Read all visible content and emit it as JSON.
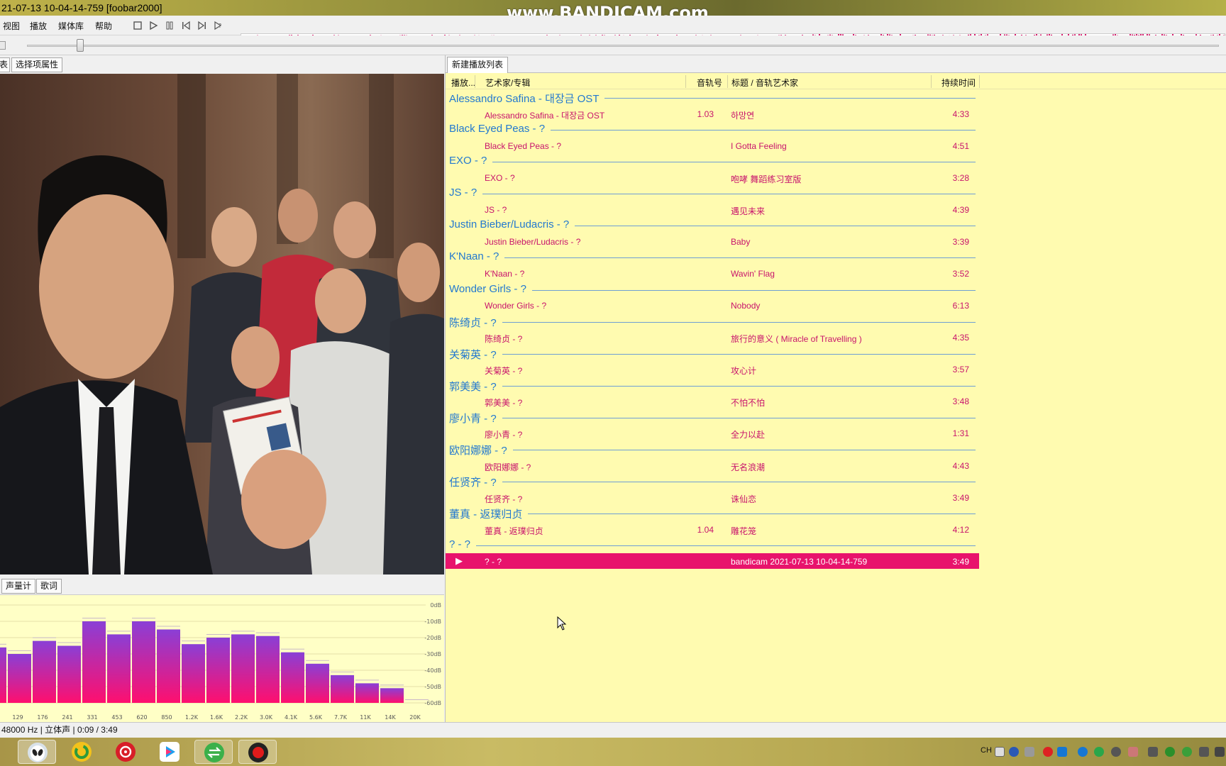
{
  "window": {
    "title": "21-07-13 10-04-14-759  [foobar2000]",
    "watermark": "www.BANDICAM.com"
  },
  "menu": {
    "items": [
      "视图",
      "播放",
      "媒体库",
      "帮助"
    ]
  },
  "toolbar": {
    "buttons": [
      "stop-icon",
      "play-icon",
      "pause-icon",
      "previous-icon",
      "next-icon",
      "random-icon"
    ]
  },
  "seek": {
    "position_fraction": 0.04
  },
  "left_panel": {
    "top_tabs": [
      "表",
      "选择项属性"
    ],
    "bottom_tabs": [
      "声量计",
      "歌词"
    ],
    "album_art": "movie-still-image"
  },
  "spectrum": {
    "db_labels": [
      "0dB",
      "-10dB",
      "-20dB",
      "-30dB",
      "-40dB",
      "-50dB",
      "-60dB"
    ],
    "freq_labels": [
      "129",
      "176",
      "241",
      "331",
      "453",
      "620",
      "850",
      "1.2K",
      "1.6K",
      "2.2K",
      "3.0K",
      "4.1K",
      "5.6K",
      "7.7K",
      "11K",
      "14K",
      "20K"
    ],
    "bar_levels_db": [
      -26,
      -30,
      -22,
      -25,
      -10,
      -18,
      -10,
      -15,
      -24,
      -20,
      -18,
      -19,
      -29,
      -36,
      -43,
      -48,
      -51,
      -60
    ],
    "colors": {
      "top": "#8a3fd6",
      "bottom": "#ff0f6e"
    }
  },
  "playlist": {
    "tab": "新建播放列表",
    "columns": {
      "playing": "播放...",
      "artist_album": "艺术家/专辑",
      "track_no": "音轨号",
      "title_artist": "标题 / 音轨艺术家",
      "duration": "持续时间"
    },
    "groups": [
      {
        "header": "Alessandro Safina - 대장금 OST",
        "tracks": [
          {
            "artist": "Alessandro Safina - 대장금 OST",
            "num": "1.03",
            "title": "하망연",
            "dur": "4:33"
          }
        ]
      },
      {
        "header": "Black Eyed Peas - ?",
        "tracks": [
          {
            "artist": "Black Eyed Peas - ?",
            "num": "",
            "title": "I Gotta Feeling",
            "dur": "4:51"
          }
        ]
      },
      {
        "header": "EXO - ?",
        "tracks": [
          {
            "artist": "EXO - ?",
            "num": "",
            "title": "咆哮 舞蹈练习室版",
            "dur": "3:28"
          }
        ]
      },
      {
        "header": "JS - ?",
        "tracks": [
          {
            "artist": "JS - ?",
            "num": "",
            "title": "遇见未来",
            "dur": "4:39"
          }
        ]
      },
      {
        "header": "Justin Bieber/Ludacris - ?",
        "tracks": [
          {
            "artist": "Justin Bieber/Ludacris - ?",
            "num": "",
            "title": "Baby",
            "dur": "3:39"
          }
        ]
      },
      {
        "header": "K'Naan - ?",
        "tracks": [
          {
            "artist": "K'Naan - ?",
            "num": "",
            "title": "Wavin' Flag",
            "dur": "3:52"
          }
        ]
      },
      {
        "header": "Wonder Girls - ?",
        "tracks": [
          {
            "artist": "Wonder Girls - ?",
            "num": "",
            "title": "Nobody",
            "dur": "6:13"
          }
        ]
      },
      {
        "header": "陈绮贞 - ?",
        "tracks": [
          {
            "artist": "陈绮贞 - ?",
            "num": "",
            "title": "旅行的意义 ( Miracle of Travelling )",
            "dur": "4:35"
          }
        ]
      },
      {
        "header": "关菊英 - ?",
        "tracks": [
          {
            "artist": "关菊英 - ?",
            "num": "",
            "title": "攻心计",
            "dur": "3:57"
          }
        ]
      },
      {
        "header": "郭美美 - ?",
        "tracks": [
          {
            "artist": "郭美美 - ?",
            "num": "",
            "title": "不怕不怕",
            "dur": "3:48"
          }
        ]
      },
      {
        "header": "廖小青 - ?",
        "tracks": [
          {
            "artist": "廖小青 - ?",
            "num": "",
            "title": "全力以赴",
            "dur": "1:31"
          }
        ]
      },
      {
        "header": "欧阳娜娜 - ?",
        "tracks": [
          {
            "artist": "欧阳娜娜 - ?",
            "num": "",
            "title": "无名浪潮",
            "dur": "4:43"
          }
        ]
      },
      {
        "header": "任贤齐 - ?",
        "tracks": [
          {
            "artist": "任贤齐 - ?",
            "num": "",
            "title": "诛仙恋",
            "dur": "3:49"
          }
        ]
      },
      {
        "header": "董真 - 返璞归贞",
        "tracks": [
          {
            "artist": "董真 - 返璞归贞",
            "num": "1.04",
            "title": "雕花笼",
            "dur": "4:12"
          }
        ]
      },
      {
        "header": "? - ?",
        "tracks": [
          {
            "artist": "? - ?",
            "num": "",
            "title": "bandicam 2021-07-13 10-04-14-759",
            "dur": "3:49",
            "playing": true
          }
        ]
      }
    ],
    "colors": {
      "background": "#fffbb0",
      "group_header": "#2379cf",
      "track_text": "#c8136c",
      "selection": "#e8136c"
    }
  },
  "status": {
    "text": "48000 Hz | 立体声 | 0:09 / 3:49"
  },
  "taskbar": {
    "apps": [
      "alien-app-icon",
      "green-circle-app-icon",
      "netease-music-icon",
      "youku-icon",
      "green-arrows-app-icon",
      "bandicam-record-icon"
    ],
    "ime": "CH"
  }
}
